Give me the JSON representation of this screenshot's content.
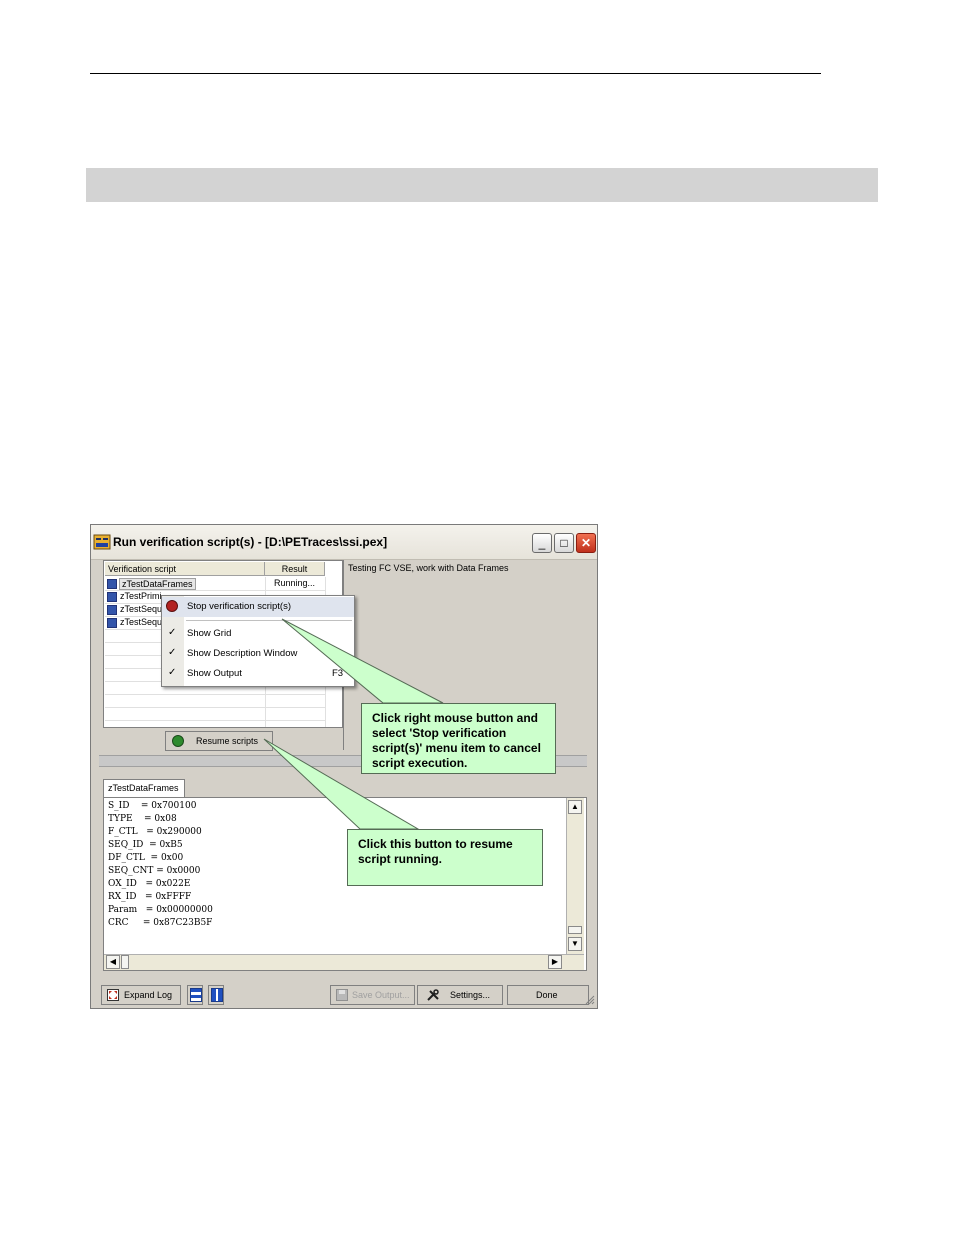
{
  "window": {
    "title": "Run verification script(s) -",
    "path": "[D:\\PETraces\\ssi.pex]",
    "controls": {
      "minimize": "_",
      "maximize": "□",
      "close": "✕"
    }
  },
  "script_list": {
    "headers": {
      "script": "Verification script",
      "result": "Result"
    },
    "rows": [
      {
        "name": "zTestDataFrames",
        "result": "Running..."
      },
      {
        "name": "zTestPrimi",
        "result": ""
      },
      {
        "name": "zTestSequ",
        "result": ""
      },
      {
        "name": "zTestSequ",
        "result": ""
      }
    ]
  },
  "description": {
    "text": "Testing FC VSE, work with Data Frames"
  },
  "context_menu": {
    "stop": "Stop verification script(s)",
    "show_grid": "Show Grid",
    "show_description": "Show Description Window",
    "show_output": "Show Output",
    "show_output_key": "F3",
    "check": "✓"
  },
  "resume_button": {
    "label": "Resume scripts"
  },
  "output": {
    "tab_label": "zTestDataFrames",
    "lines": [
      "S_ID    = 0x700100",
      "TYPE    = 0x08",
      "F_CTL   = 0x290000",
      "SEQ_ID  = 0xB5",
      "DF_CTL  = 0x00",
      "SEQ_CNT = 0x0000",
      "OX_ID   = 0x022E",
      "RX_ID   = 0xFFFF",
      "Param   = 0x00000000",
      "CRC     = 0x87C23B5F"
    ],
    "scroll_up": "▲",
    "scroll_down": "▼",
    "scroll_left": "◀",
    "scroll_right": "▶"
  },
  "bottom_bar": {
    "expand_log": "Expand Log",
    "save_output": "Save Output...",
    "settings": "Settings...",
    "done": "Done"
  },
  "callouts": {
    "stop_hint": "Click right mouse button and select 'Stop verification script(s)' menu item to cancel script execution.",
    "resume_hint": "Click this button to resume script running."
  },
  "colors": {
    "callout_fill": "#ccffcc",
    "section_bar": "#d3d3d3",
    "window_face": "#d4d0c8"
  }
}
